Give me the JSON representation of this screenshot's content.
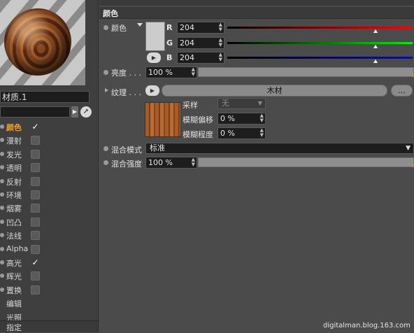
{
  "left": {
    "material_name": "材质.1",
    "channels": [
      {
        "label": "颜色",
        "active": true,
        "checked": true
      },
      {
        "label": "漫射",
        "active": false,
        "checked": false
      },
      {
        "label": "发光",
        "active": false,
        "checked": false
      },
      {
        "label": "透明",
        "active": false,
        "checked": false
      },
      {
        "label": "反射",
        "active": false,
        "checked": false
      },
      {
        "label": "环境",
        "active": false,
        "checked": false
      },
      {
        "label": "烟雾",
        "active": false,
        "checked": false
      },
      {
        "label": "凹凸",
        "active": false,
        "checked": false
      },
      {
        "label": "法线",
        "active": false,
        "checked": false
      },
      {
        "label": "Alpha",
        "active": false,
        "checked": false
      },
      {
        "label": "高光",
        "active": false,
        "checked": true
      },
      {
        "label": "辉光",
        "active": false,
        "checked": false
      },
      {
        "label": "置换",
        "active": false,
        "checked": false
      },
      {
        "label": "编辑",
        "active": false,
        "checked": null
      },
      {
        "label": "光照",
        "active": false,
        "checked": null
      }
    ],
    "assign_label": "指定"
  },
  "panel": {
    "title": "颜色",
    "color_label": "颜色",
    "r_label": "R",
    "g_label": "G",
    "b_label": "B",
    "r_value": "204",
    "g_value": "204",
    "b_value": "204",
    "r_fraction": 0.8,
    "g_fraction": 0.8,
    "b_fraction": 0.8,
    "brightness_label": "亮度 . . .",
    "brightness_value": "100 %",
    "texture_label": "纹理 . . .",
    "texture_name": "木材",
    "texture_more": "...",
    "sampling_label": "采样",
    "sampling_value": "无",
    "blur_offset_label": "模糊偏移",
    "blur_offset_value": "0 %",
    "blur_scale_label": "模糊程度",
    "blur_scale_value": "0 %",
    "blend_mode_label": "混合模式",
    "blend_mode_value": "标准",
    "blend_strength_label": "混合强度",
    "blend_strength_value": "100 %"
  },
  "colors": {
    "accent": "#f0a030",
    "swatch": "#cccccc"
  },
  "watermark": "digitalman.blog.163.com"
}
